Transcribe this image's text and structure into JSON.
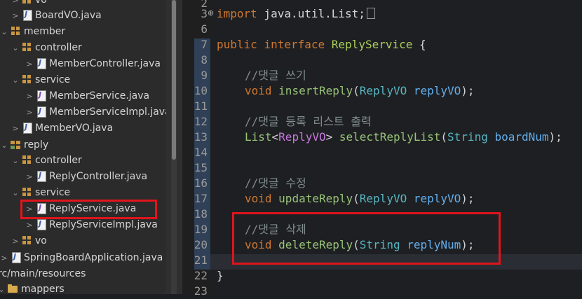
{
  "explorer": {
    "items": [
      {
        "label": "vo",
        "icon": "package-icon",
        "kind": "pkg"
      },
      {
        "label": "BoardVO.java",
        "icon": "java-class-file-icon",
        "kind": "file"
      },
      {
        "label": "member",
        "icon": "package-icon",
        "kind": "pkg"
      },
      {
        "label": "controller",
        "icon": "package-icon",
        "kind": "pkg"
      },
      {
        "label": "MemberController.java",
        "icon": "java-class-file-icon",
        "kind": "file"
      },
      {
        "label": "service",
        "icon": "package-icon",
        "kind": "pkg"
      },
      {
        "label": "MemberService.java",
        "icon": "java-interface-file-icon",
        "kind": "iface"
      },
      {
        "label": "MemberServiceImpl.java",
        "icon": "java-class-file-icon",
        "kind": "file"
      },
      {
        "label": "MemberVO.java",
        "icon": "java-class-file-icon",
        "kind": "file"
      },
      {
        "label": "reply",
        "icon": "package-cluster-icon",
        "kind": "cluster"
      },
      {
        "label": "controller",
        "icon": "package-icon",
        "kind": "pkg"
      },
      {
        "label": "ReplyController.java",
        "icon": "java-class-file-icon",
        "kind": "file"
      },
      {
        "label": "service",
        "icon": "package-icon",
        "kind": "pkg"
      },
      {
        "label": "ReplyService.java",
        "icon": "java-interface-file-icon",
        "kind": "iface"
      },
      {
        "label": "ReplyServiceImpl.java",
        "icon": "java-class-file-icon",
        "kind": "file"
      },
      {
        "label": "vo",
        "icon": "package-icon",
        "kind": "pkg"
      },
      {
        "label": "SpringBoardApplication.java",
        "icon": "java-class-file-icon",
        "kind": "file"
      },
      {
        "label": "rc/main/resources",
        "icon": "folder-icon",
        "kind": "folder"
      },
      {
        "label": "mappers",
        "icon": "folder-icon",
        "kind": "folder"
      }
    ]
  },
  "editor": {
    "line_numbers": [
      "2",
      "3",
      "6",
      "7",
      "8",
      "9",
      "10",
      "11",
      "12",
      "13",
      "14",
      "15",
      "16",
      "17",
      "18",
      "19",
      "20",
      "21",
      "22",
      "23"
    ],
    "code": {
      "l3_import": "import",
      "l3_rest": " java.util.List;",
      "l7_public": "public",
      "l7_interface": "interface",
      "l7_name": "ReplyService",
      "l7_brace": " {",
      "l9_comment": "//댓글 쓰기",
      "l10_void": "void",
      "l10_method": "insertReply",
      "l10_open": "(",
      "l10_type": "ReplyVO",
      "l10_param": "replyVO",
      "l10_close": ");",
      "l12_comment": "//댓글 등록 리스트 출력",
      "l13_list": "List",
      "l13_lt": "<",
      "l13_vo": "ReplyVO",
      "l13_gt": ">",
      "l13_method": "selectReplyList",
      "l13_open": "(",
      "l13_type": "String",
      "l13_param": "boardNum",
      "l13_close": ");",
      "l16_comment": "//댓글 수정",
      "l17_void": "void",
      "l17_method": "updateReply",
      "l17_open": "(",
      "l17_type": "ReplyVO",
      "l17_param": "replyVO",
      "l17_close": ");",
      "l19_comment": "//댓글 삭제",
      "l20_void": "void",
      "l20_method": "deleteReply",
      "l20_open": "(",
      "l20_type": "String",
      "l20_param": "replyNum",
      "l20_close": ");",
      "l22_brace": "}"
    }
  },
  "colors": {
    "highlight_box": "#e0141c",
    "keyword": "#cc7832",
    "comment": "#7f8c8d"
  }
}
